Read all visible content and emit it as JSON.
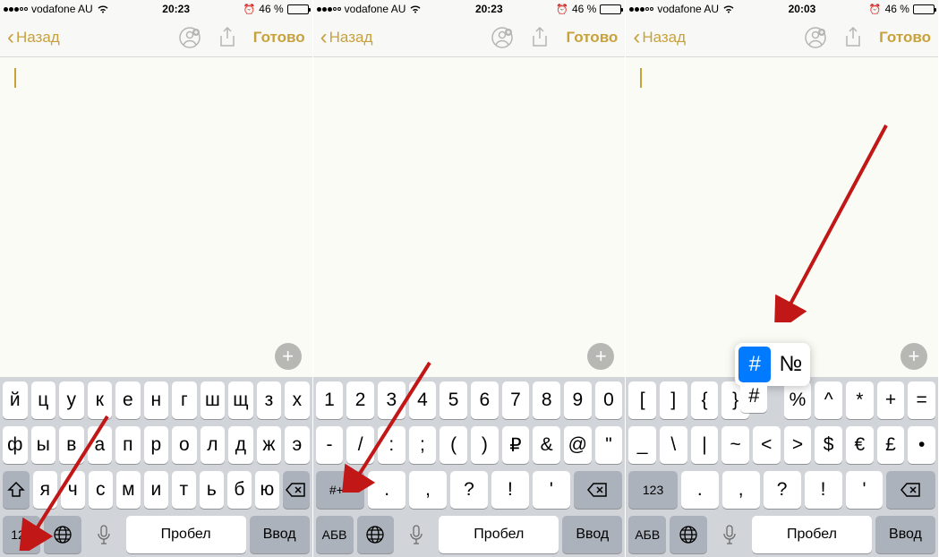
{
  "screens": [
    {
      "status": {
        "carrier": "vodafone AU",
        "time": "20:23",
        "battery": "46 %"
      },
      "nav": {
        "back": "Назад",
        "done": "Готово"
      },
      "keyboard": {
        "row1": [
          "й",
          "ц",
          "у",
          "к",
          "е",
          "н",
          "г",
          "ш",
          "щ",
          "з",
          "х"
        ],
        "row2": [
          "ф",
          "ы",
          "в",
          "а",
          "п",
          "р",
          "о",
          "л",
          "д",
          "ж",
          "э"
        ],
        "row3": [
          "я",
          "ч",
          "с",
          "м",
          "и",
          "т",
          "ь",
          "б",
          "ю"
        ],
        "fn_left": "123",
        "space": "Пробел",
        "enter": "Ввод"
      }
    },
    {
      "status": {
        "carrier": "vodafone AU",
        "time": "20:23",
        "battery": "46 %"
      },
      "nav": {
        "back": "Назад",
        "done": "Готово"
      },
      "keyboard": {
        "row1": [
          "1",
          "2",
          "3",
          "4",
          "5",
          "6",
          "7",
          "8",
          "9",
          "0"
        ],
        "row2": [
          "-",
          "/",
          ":",
          ";",
          "(",
          ")",
          "₽",
          "&",
          "@",
          "\""
        ],
        "row3_switch": "#+=",
        "row3": [
          ".",
          ",",
          "?",
          "!",
          "'"
        ],
        "fn_left": "АБВ",
        "space": "Пробел",
        "enter": "Ввод"
      }
    },
    {
      "status": {
        "carrier": "vodafone AU",
        "time": "20:03",
        "battery": "46 %"
      },
      "nav": {
        "back": "Назад",
        "done": "Готово"
      },
      "keyboard": {
        "row1": [
          "[",
          "]",
          "{",
          "}",
          "#",
          "%",
          "^",
          "*",
          "+",
          "="
        ],
        "row2": [
          "_",
          "\\",
          "|",
          "~",
          "<",
          ">",
          "$",
          "€",
          "£",
          "•"
        ],
        "row3_switch": "123",
        "row3": [
          ".",
          ",",
          "?",
          "!",
          "'"
        ],
        "fn_left": "АБВ",
        "space": "Пробел",
        "enter": "Ввод"
      },
      "popup": {
        "selected": "#",
        "alt": "№",
        "tail": "#"
      }
    }
  ]
}
